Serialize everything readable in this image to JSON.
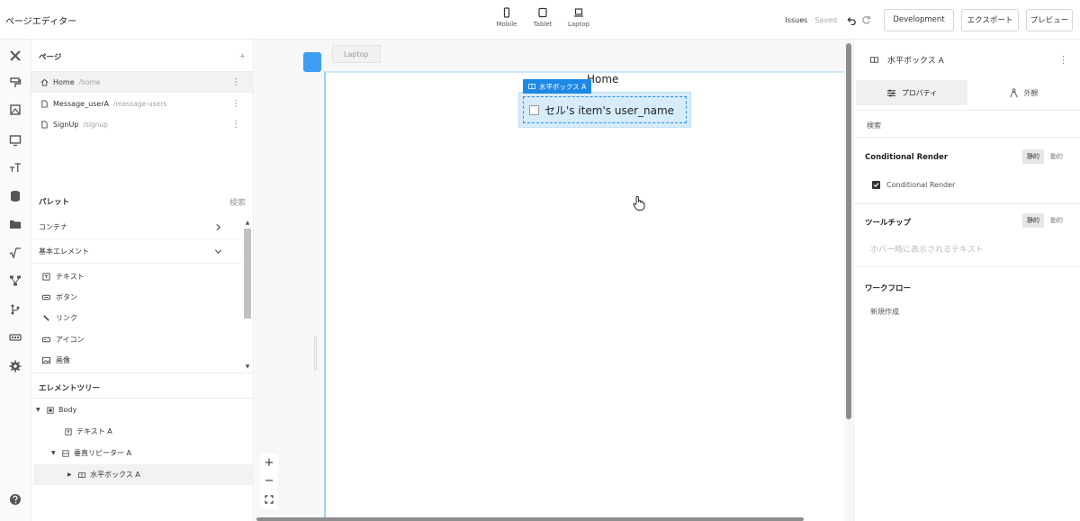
{
  "header": {
    "title": "ページエディター",
    "devices": [
      {
        "label": "Mobile",
        "icon": "mobile-icon"
      },
      {
        "label": "Tablet",
        "icon": "tablet-icon"
      },
      {
        "label": "Laptop",
        "icon": "laptop-icon"
      }
    ],
    "issues": "Issues",
    "saved": "Saved",
    "development_label": "Development",
    "export_label": "エクスポート",
    "preview_label": "プレビュー"
  },
  "pages": {
    "title": "ページ",
    "add": "+",
    "items": [
      {
        "name": "Home",
        "path": "/home"
      },
      {
        "name": "Message_userA",
        "path": "/message-users"
      },
      {
        "name": "SignUp",
        "path": "/signup"
      }
    ]
  },
  "palette": {
    "title": "パレット",
    "search": "検索",
    "categories": [
      "コンテナ",
      "基本エレメント"
    ],
    "elements": [
      "テキスト",
      "ボタン",
      "リンク",
      "アイコン",
      "画像"
    ]
  },
  "tree": {
    "title": "エレメントツリー",
    "items": [
      {
        "label": "Body"
      },
      {
        "label": "テキスト A"
      },
      {
        "label": "垂直リピーター A"
      },
      {
        "label": "水平ボックス A"
      }
    ]
  },
  "canvas": {
    "device_tab": "Laptop",
    "page_title": "Home",
    "selected_badge": "水平ボックス A",
    "selected_text": "セル's item's user_name"
  },
  "props": {
    "element_name": "水平ボックス A",
    "tabs": [
      "プロパティ",
      "外観"
    ],
    "search": "検索",
    "conditional": {
      "title": "Conditional Render",
      "static": "静的",
      "dynamic": "動的",
      "checkbox_label": "Conditional Render"
    },
    "tooltip": {
      "title": "ツールチップ",
      "static": "静的",
      "dynamic": "動的",
      "placeholder": "ホバー時に表示されるテキスト"
    },
    "workflow": {
      "title": "ワークフロー",
      "new": "新規作成"
    }
  },
  "colors": {
    "accent": "#1e88e5",
    "selection_bg": "#d6ecfa"
  }
}
